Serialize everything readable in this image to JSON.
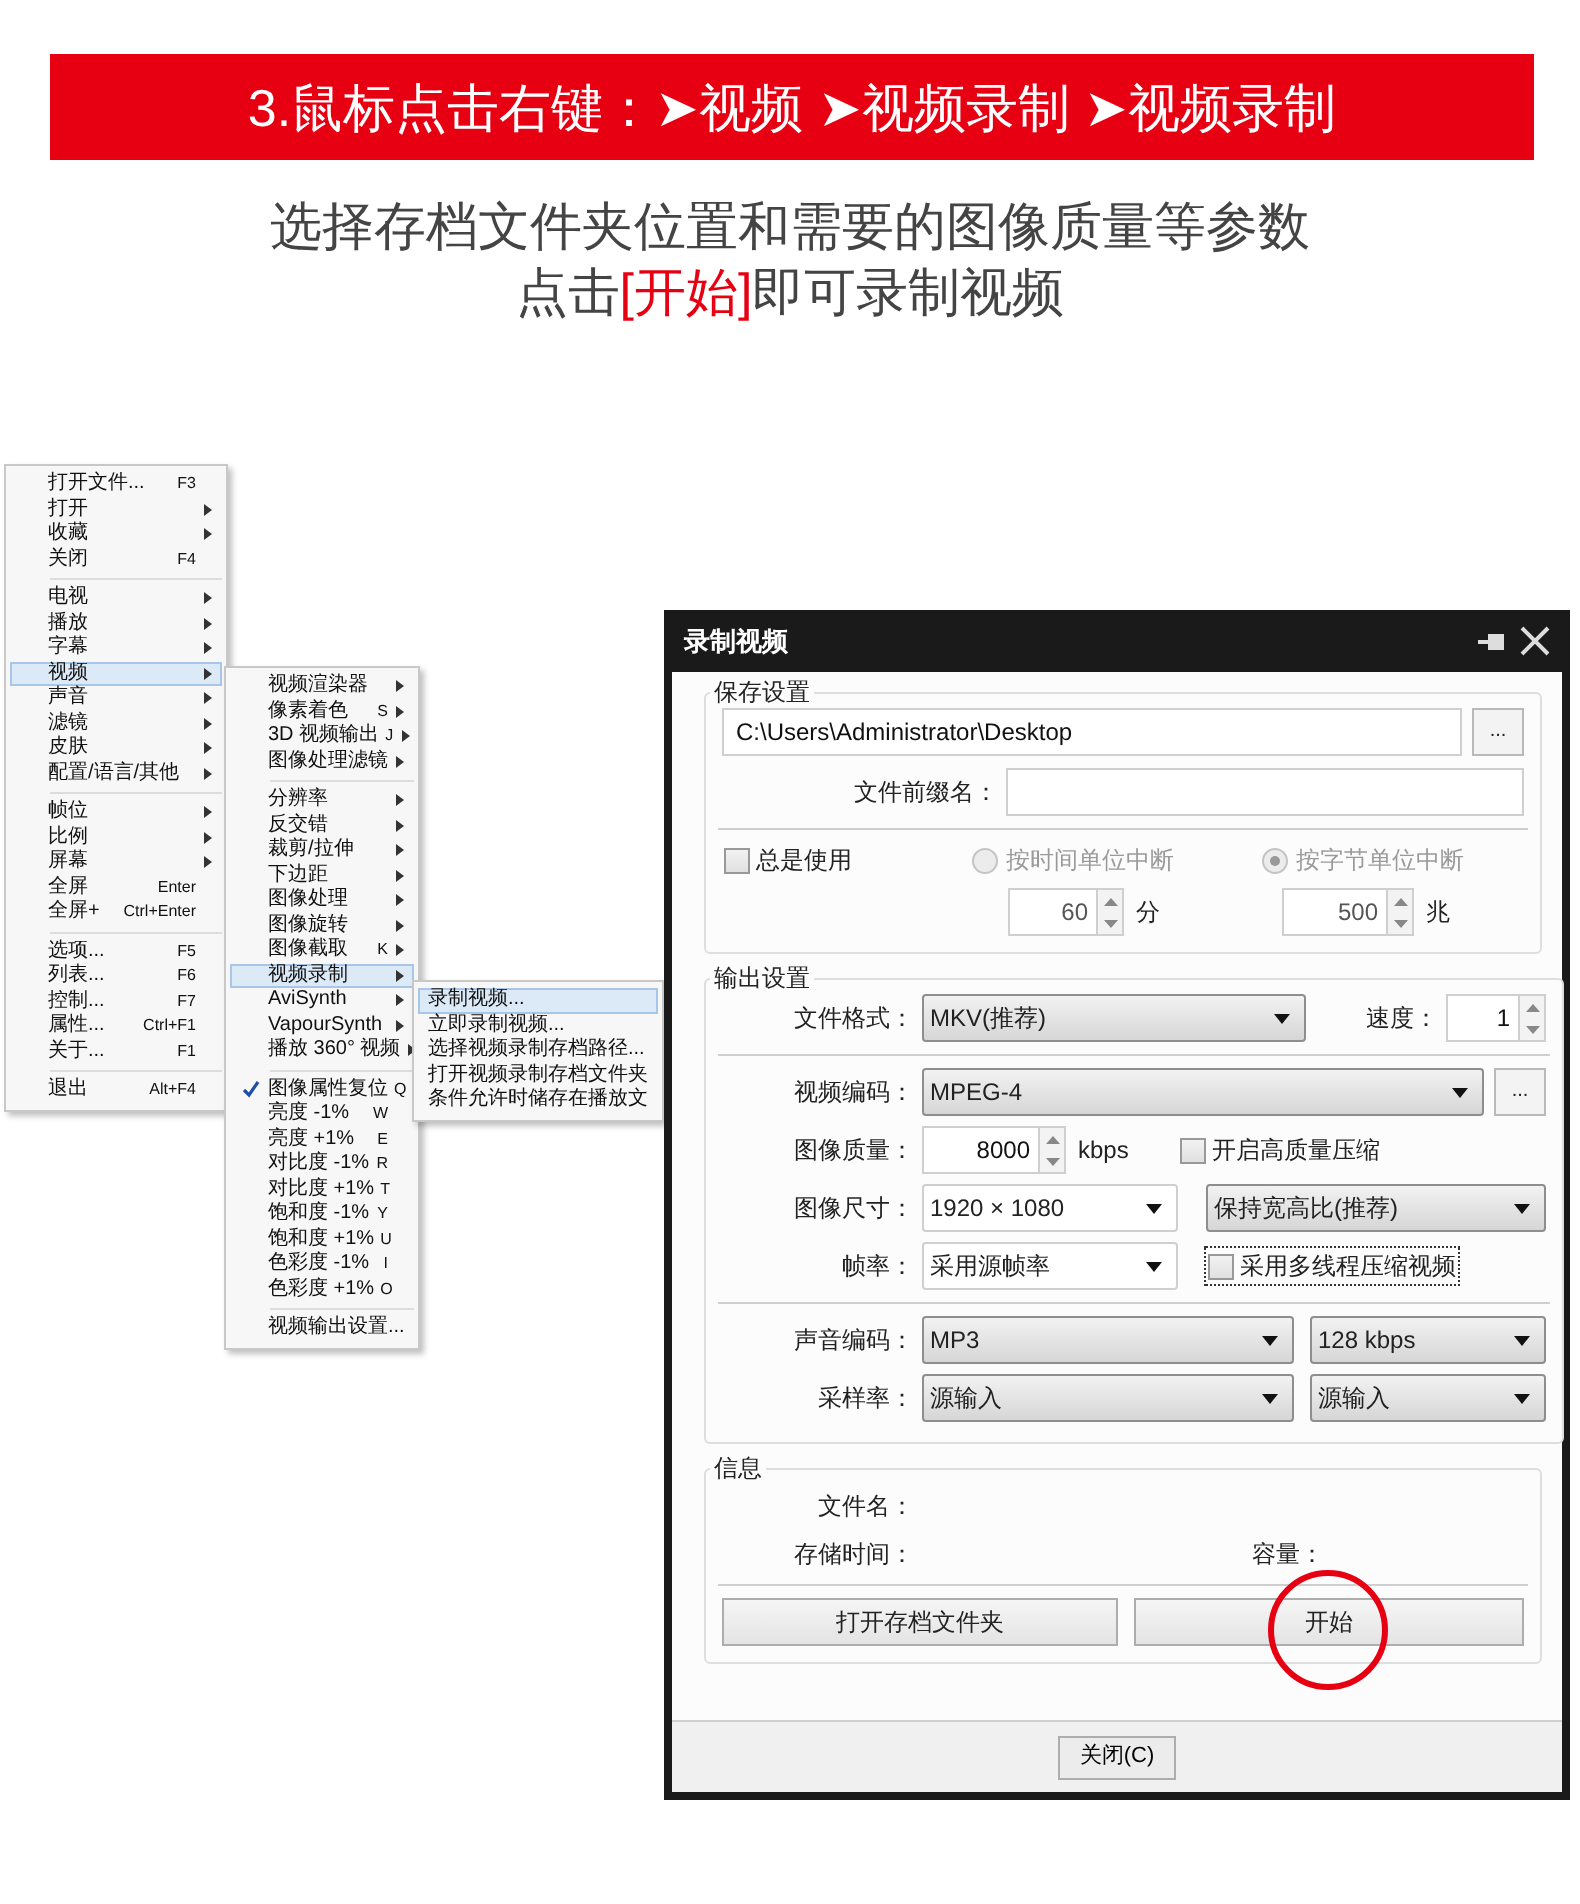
{
  "banner": {
    "title": "3.鼠标点击右键：➤视频 ➤视频录制 ➤视频录制"
  },
  "instructions": {
    "line_1": "选择存档文件夹位置和需要的图像质量等参数",
    "line_2": {
      "before": "点击",
      "highlight": "[开始]",
      "after": "即可录制视频"
    }
  },
  "context_menu": {
    "items": [
      {
        "kind": "item",
        "label": "打开文件...",
        "shortcut": "F3",
        "submenu": false,
        "selected": false
      },
      {
        "kind": "item",
        "label": "打开",
        "submenu": true,
        "selected": false
      },
      {
        "kind": "item",
        "label": "收藏",
        "submenu": true,
        "selected": false
      },
      {
        "kind": "item",
        "label": "关闭",
        "shortcut": "F4",
        "submenu": false,
        "selected": false
      },
      {
        "kind": "separator"
      },
      {
        "kind": "item",
        "label": "电视",
        "submenu": true,
        "selected": false
      },
      {
        "kind": "item",
        "label": "播放",
        "submenu": true,
        "selected": false
      },
      {
        "kind": "item",
        "label": "字幕",
        "submenu": true,
        "selected": false
      },
      {
        "kind": "item",
        "label": "视频",
        "submenu": true,
        "selected": true
      },
      {
        "kind": "item",
        "label": "声音",
        "submenu": true,
        "selected": false
      },
      {
        "kind": "item",
        "label": "滤镜",
        "submenu": true,
        "selected": false
      },
      {
        "kind": "item",
        "label": "皮肤",
        "submenu": true,
        "selected": false
      },
      {
        "kind": "item",
        "label": "配置/语言/其他",
        "submenu": true,
        "selected": false
      },
      {
        "kind": "separator"
      },
      {
        "kind": "item",
        "label": "帧位",
        "submenu": true,
        "selected": false
      },
      {
        "kind": "item",
        "label": "比例",
        "submenu": true,
        "selected": false
      },
      {
        "kind": "item",
        "label": "屏幕",
        "submenu": true,
        "selected": false
      },
      {
        "kind": "item",
        "label": "全屏",
        "shortcut": "Enter",
        "submenu": false,
        "selected": false
      },
      {
        "kind": "item",
        "label": "全屏+",
        "shortcut": "Ctrl+Enter",
        "submenu": false,
        "selected": false
      },
      {
        "kind": "separator"
      },
      {
        "kind": "item",
        "label": "选项...",
        "shortcut": "F5",
        "submenu": false,
        "selected": false
      },
      {
        "kind": "item",
        "label": "列表...",
        "shortcut": "F6",
        "submenu": false,
        "selected": false
      },
      {
        "kind": "item",
        "label": "控制...",
        "shortcut": "F7",
        "submenu": false,
        "selected": false
      },
      {
        "kind": "item",
        "label": "属性...",
        "shortcut": "Ctrl+F1",
        "submenu": false,
        "selected": false
      },
      {
        "kind": "item",
        "label": "关于...",
        "shortcut": "F1",
        "submenu": false,
        "selected": false
      },
      {
        "kind": "separator"
      },
      {
        "kind": "item",
        "label": "退出",
        "shortcut": "Alt+F4",
        "submenu": false,
        "selected": false
      }
    ]
  },
  "video_submenu": {
    "items": [
      {
        "kind": "item",
        "label": "视频渲染器",
        "submenu": true,
        "selected": false,
        "checked": false
      },
      {
        "kind": "item",
        "label": "像素着色",
        "shortcut": "S",
        "submenu": true,
        "selected": false,
        "checked": false
      },
      {
        "kind": "item",
        "label": "3D 视频输出",
        "shortcut": "J",
        "submenu": true,
        "selected": false,
        "checked": false
      },
      {
        "kind": "item",
        "label": "图像处理滤镜",
        "submenu": true,
        "selected": false,
        "checked": false
      },
      {
        "kind": "separator"
      },
      {
        "kind": "item",
        "label": "分辨率",
        "submenu": true,
        "selected": false,
        "checked": false
      },
      {
        "kind": "item",
        "label": "反交错",
        "submenu": true,
        "selected": false,
        "checked": false
      },
      {
        "kind": "item",
        "label": "裁剪/拉伸",
        "submenu": true,
        "selected": false,
        "checked": false
      },
      {
        "kind": "item",
        "label": "下边距",
        "submenu": true,
        "selected": false,
        "checked": false
      },
      {
        "kind": "item",
        "label": "图像处理",
        "submenu": true,
        "selected": false,
        "checked": false
      },
      {
        "kind": "item",
        "label": "图像旋转",
        "submenu": true,
        "selected": false,
        "checked": false
      },
      {
        "kind": "item",
        "label": "图像截取",
        "shortcut": "K",
        "submenu": true,
        "selected": false,
        "checked": false
      },
      {
        "kind": "item",
        "label": "视频录制",
        "submenu": true,
        "selected": true,
        "checked": false
      },
      {
        "kind": "item",
        "label": "AviSynth",
        "submenu": true,
        "selected": false,
        "checked": false
      },
      {
        "kind": "item",
        "label": "VapourSynth",
        "submenu": true,
        "selected": false,
        "checked": false
      },
      {
        "kind": "item",
        "label": "播放 360° 视频",
        "submenu": true,
        "selected": false,
        "checked": false
      },
      {
        "kind": "separator"
      },
      {
        "kind": "item",
        "label": "图像属性复位",
        "shortcut": "Q",
        "submenu": false,
        "selected": false,
        "checked": true
      },
      {
        "kind": "item",
        "label": "亮度 -1%",
        "shortcut": "W",
        "submenu": false,
        "selected": false,
        "checked": false
      },
      {
        "kind": "item",
        "label": "亮度 +1%",
        "shortcut": "E",
        "submenu": false,
        "selected": false,
        "checked": false
      },
      {
        "kind": "item",
        "label": "对比度 -1%",
        "shortcut": "R",
        "submenu": false,
        "selected": false,
        "checked": false
      },
      {
        "kind": "item",
        "label": "对比度 +1%",
        "shortcut": "T",
        "submenu": false,
        "selected": false,
        "checked": false
      },
      {
        "kind": "item",
        "label": "饱和度 -1%",
        "shortcut": "Y",
        "submenu": false,
        "selected": false,
        "checked": false
      },
      {
        "kind": "item",
        "label": "饱和度 +1%",
        "shortcut": "U",
        "submenu": false,
        "selected": false,
        "checked": false
      },
      {
        "kind": "item",
        "label": "色彩度 -1%",
        "shortcut": "I",
        "submenu": false,
        "selected": false,
        "checked": false
      },
      {
        "kind": "item",
        "label": "色彩度 +1%",
        "shortcut": "O",
        "submenu": false,
        "selected": false,
        "checked": false
      },
      {
        "kind": "separator"
      },
      {
        "kind": "item",
        "label": "视频输出设置...",
        "submenu": false,
        "selected": false,
        "checked": false
      }
    ]
  },
  "record_submenu": {
    "items": [
      {
        "kind": "item",
        "label": "录制视频...",
        "selected": true
      },
      {
        "kind": "item",
        "label": "立即录制视频...",
        "selected": false
      },
      {
        "kind": "item",
        "label": "选择视频录制存档路径...",
        "selected": false
      },
      {
        "kind": "item",
        "label": "打开视频录制存档文件夹",
        "selected": false
      },
      {
        "kind": "item",
        "label": "条件允许时储存在播放文",
        "selected": false
      }
    ]
  },
  "dialog": {
    "title": "录制视频",
    "save_settings": {
      "legend": "保存设置",
      "path": "C:\\Users\\Administrator\\Desktop",
      "browse_button": "...",
      "prefix_label": "文件前缀名：",
      "always_use": {
        "label": "总是使用",
        "checked": false
      },
      "split_by_time": {
        "label": "按时间单位中断",
        "selected": false,
        "disabled": true,
        "value": "60",
        "unit": "分"
      },
      "split_by_size": {
        "label": "按字节单位中断",
        "selected": true,
        "disabled": true,
        "value": "500",
        "unit": "兆"
      }
    },
    "output_settings": {
      "legend": "输出设置",
      "format": {
        "label": "文件格式：",
        "value": "MKV(推荐)"
      },
      "speed": {
        "label": "速度：",
        "value": "1"
      },
      "video_codec": {
        "label": "视频编码：",
        "value": "MPEG-4",
        "button": "..."
      },
      "quality": {
        "label": "图像质量：",
        "value": "8000",
        "unit": "kbps"
      },
      "hq_compress": {
        "label": "开启高质量压缩",
        "checked": false
      },
      "size": {
        "label": "图像尺寸：",
        "value": "1920 × 1080",
        "aspect": "保持宽高比(推荐)"
      },
      "framerate": {
        "label": "帧率：",
        "value": "采用源帧率"
      },
      "multithread": {
        "label": "采用多线程压缩视频",
        "checked": false,
        "focused": true
      },
      "audio_codec": {
        "label": "声音编码：",
        "value": "MP3",
        "bitrate": "128 kbps"
      },
      "sample_rate": {
        "label": "采样率：",
        "value": "源输入",
        "channels": "源输入"
      }
    },
    "info": {
      "legend": "信息",
      "file_name_label": "文件名：",
      "time_label": "存储时间：",
      "size_label": "容量：",
      "open_folder_button": "打开存档文件夹",
      "start_button": "开始",
      "start_highlighted": true
    },
    "close_button": "关闭(C)"
  }
}
